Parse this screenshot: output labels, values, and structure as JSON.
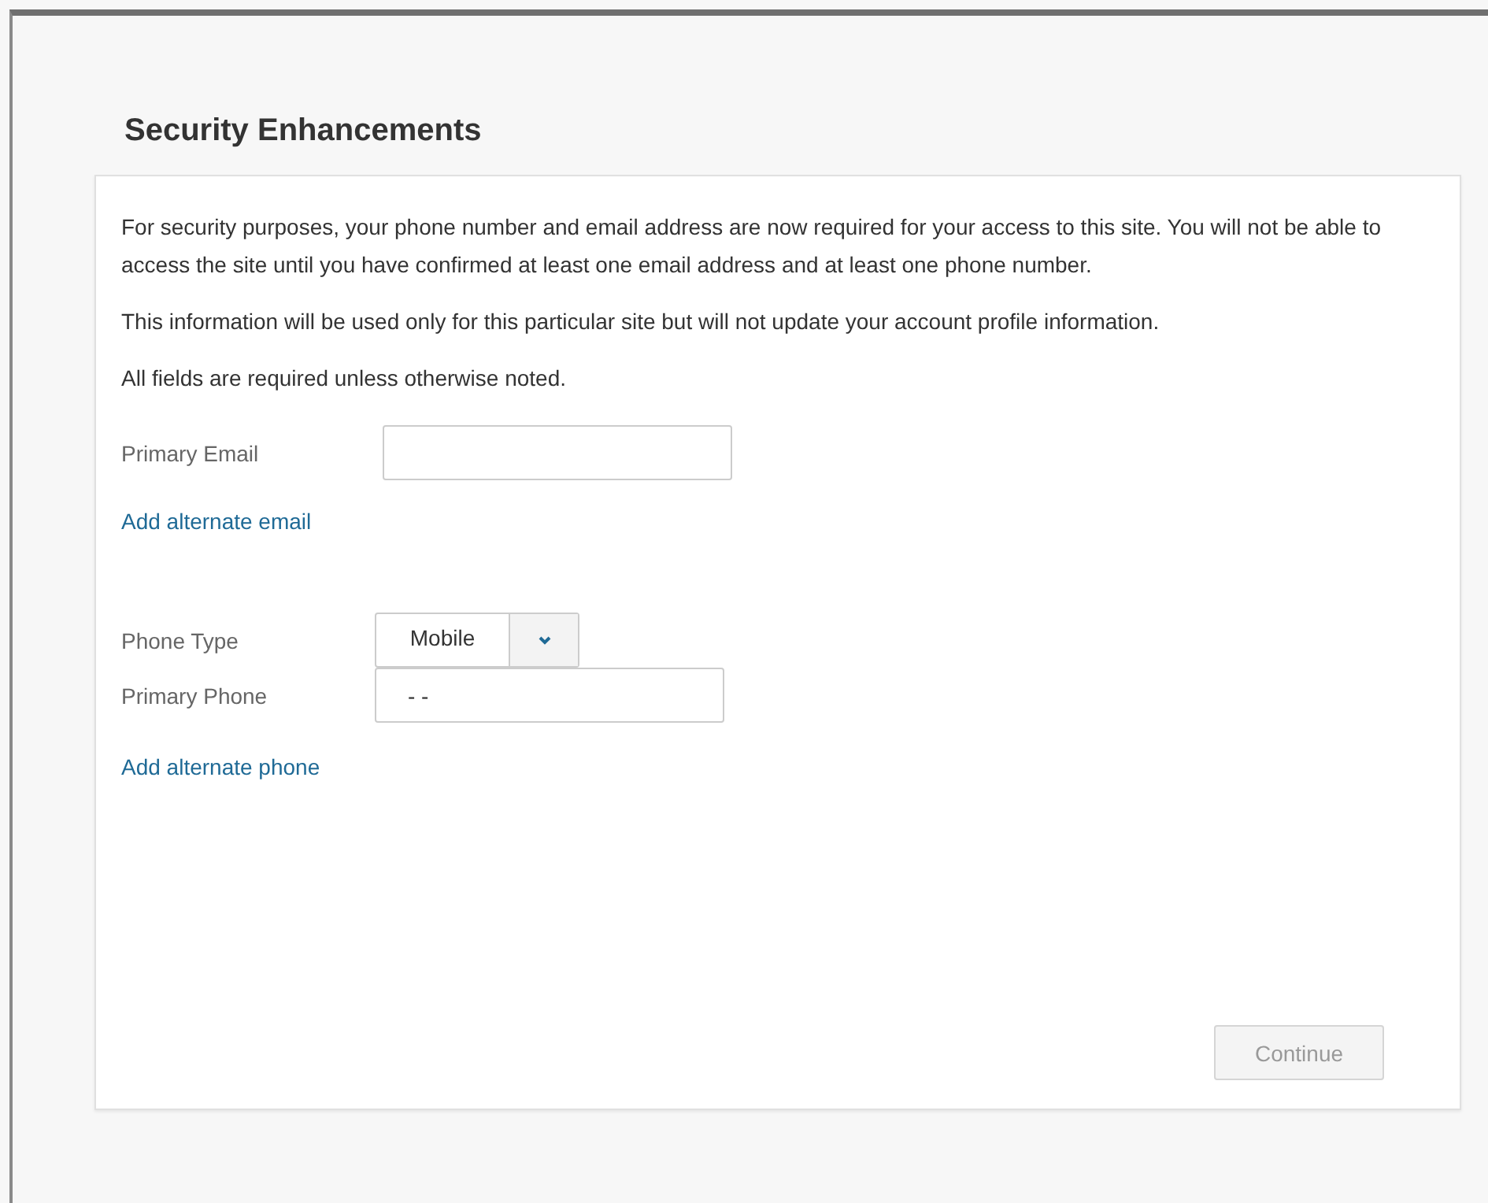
{
  "title": "Security Enhancements",
  "paragraphs": [
    "For security purposes, your phone number and email address are now required for your access to this site. You will not be able to access the site until you have confirmed at least one email address and at least one phone number.",
    "This information will be used only for this particular site but will not update your account profile information.",
    "All fields are required unless otherwise noted."
  ],
  "email": {
    "label": "Primary Email"
  },
  "add_email_link": "Add alternate email",
  "phone_type": {
    "label": "Phone Type",
    "value": "Mobile"
  },
  "phone": {
    "label": "Primary Phone",
    "value": "- -"
  },
  "add_phone_link": "Add alternate phone",
  "continue_button": {
    "label": "Continue",
    "disabled": true
  }
}
